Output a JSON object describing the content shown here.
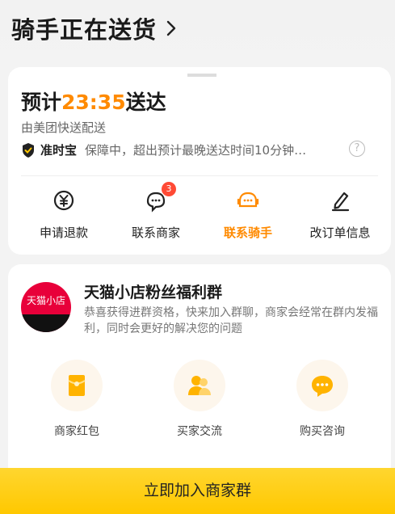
{
  "header": {
    "title": "骑手正在送货",
    "chevron_icon": "chevron-right-icon"
  },
  "delivery": {
    "eta_prefix": "预计",
    "eta_time": "23:35",
    "eta_suffix": "送达",
    "courier": "由美团快送配送",
    "guarantee_label": "准时宝",
    "guarantee_text": "保障中，超出预计最晚送达时间10分钟…",
    "help_icon": "?"
  },
  "actions": [
    {
      "label": "申请退款",
      "icon": "refund-icon"
    },
    {
      "label": "联系商家",
      "icon": "merchant-chat-icon",
      "badge": "3"
    },
    {
      "label": "联系骑手",
      "icon": "rider-chat-icon",
      "active": true
    },
    {
      "label": "改订单信息",
      "icon": "edit-icon"
    }
  ],
  "group": {
    "avatar_text": "天猫小店",
    "title": "天猫小店粉丝福利群",
    "description": "恭喜获得进群资格，快来加入群聊，商家会经常在群内发福利，同时会更好的解决您的问题",
    "features": [
      {
        "label": "商家红包",
        "icon": "red-packet-icon"
      },
      {
        "label": "买家交流",
        "icon": "buyers-icon"
      },
      {
        "label": "购买咨询",
        "icon": "chat-bubble-icon"
      }
    ]
  },
  "join_button": "立即加入商家群",
  "colors": {
    "accent": "#ff8a00",
    "button": "#ffc800",
    "badge": "#ff4a35"
  }
}
